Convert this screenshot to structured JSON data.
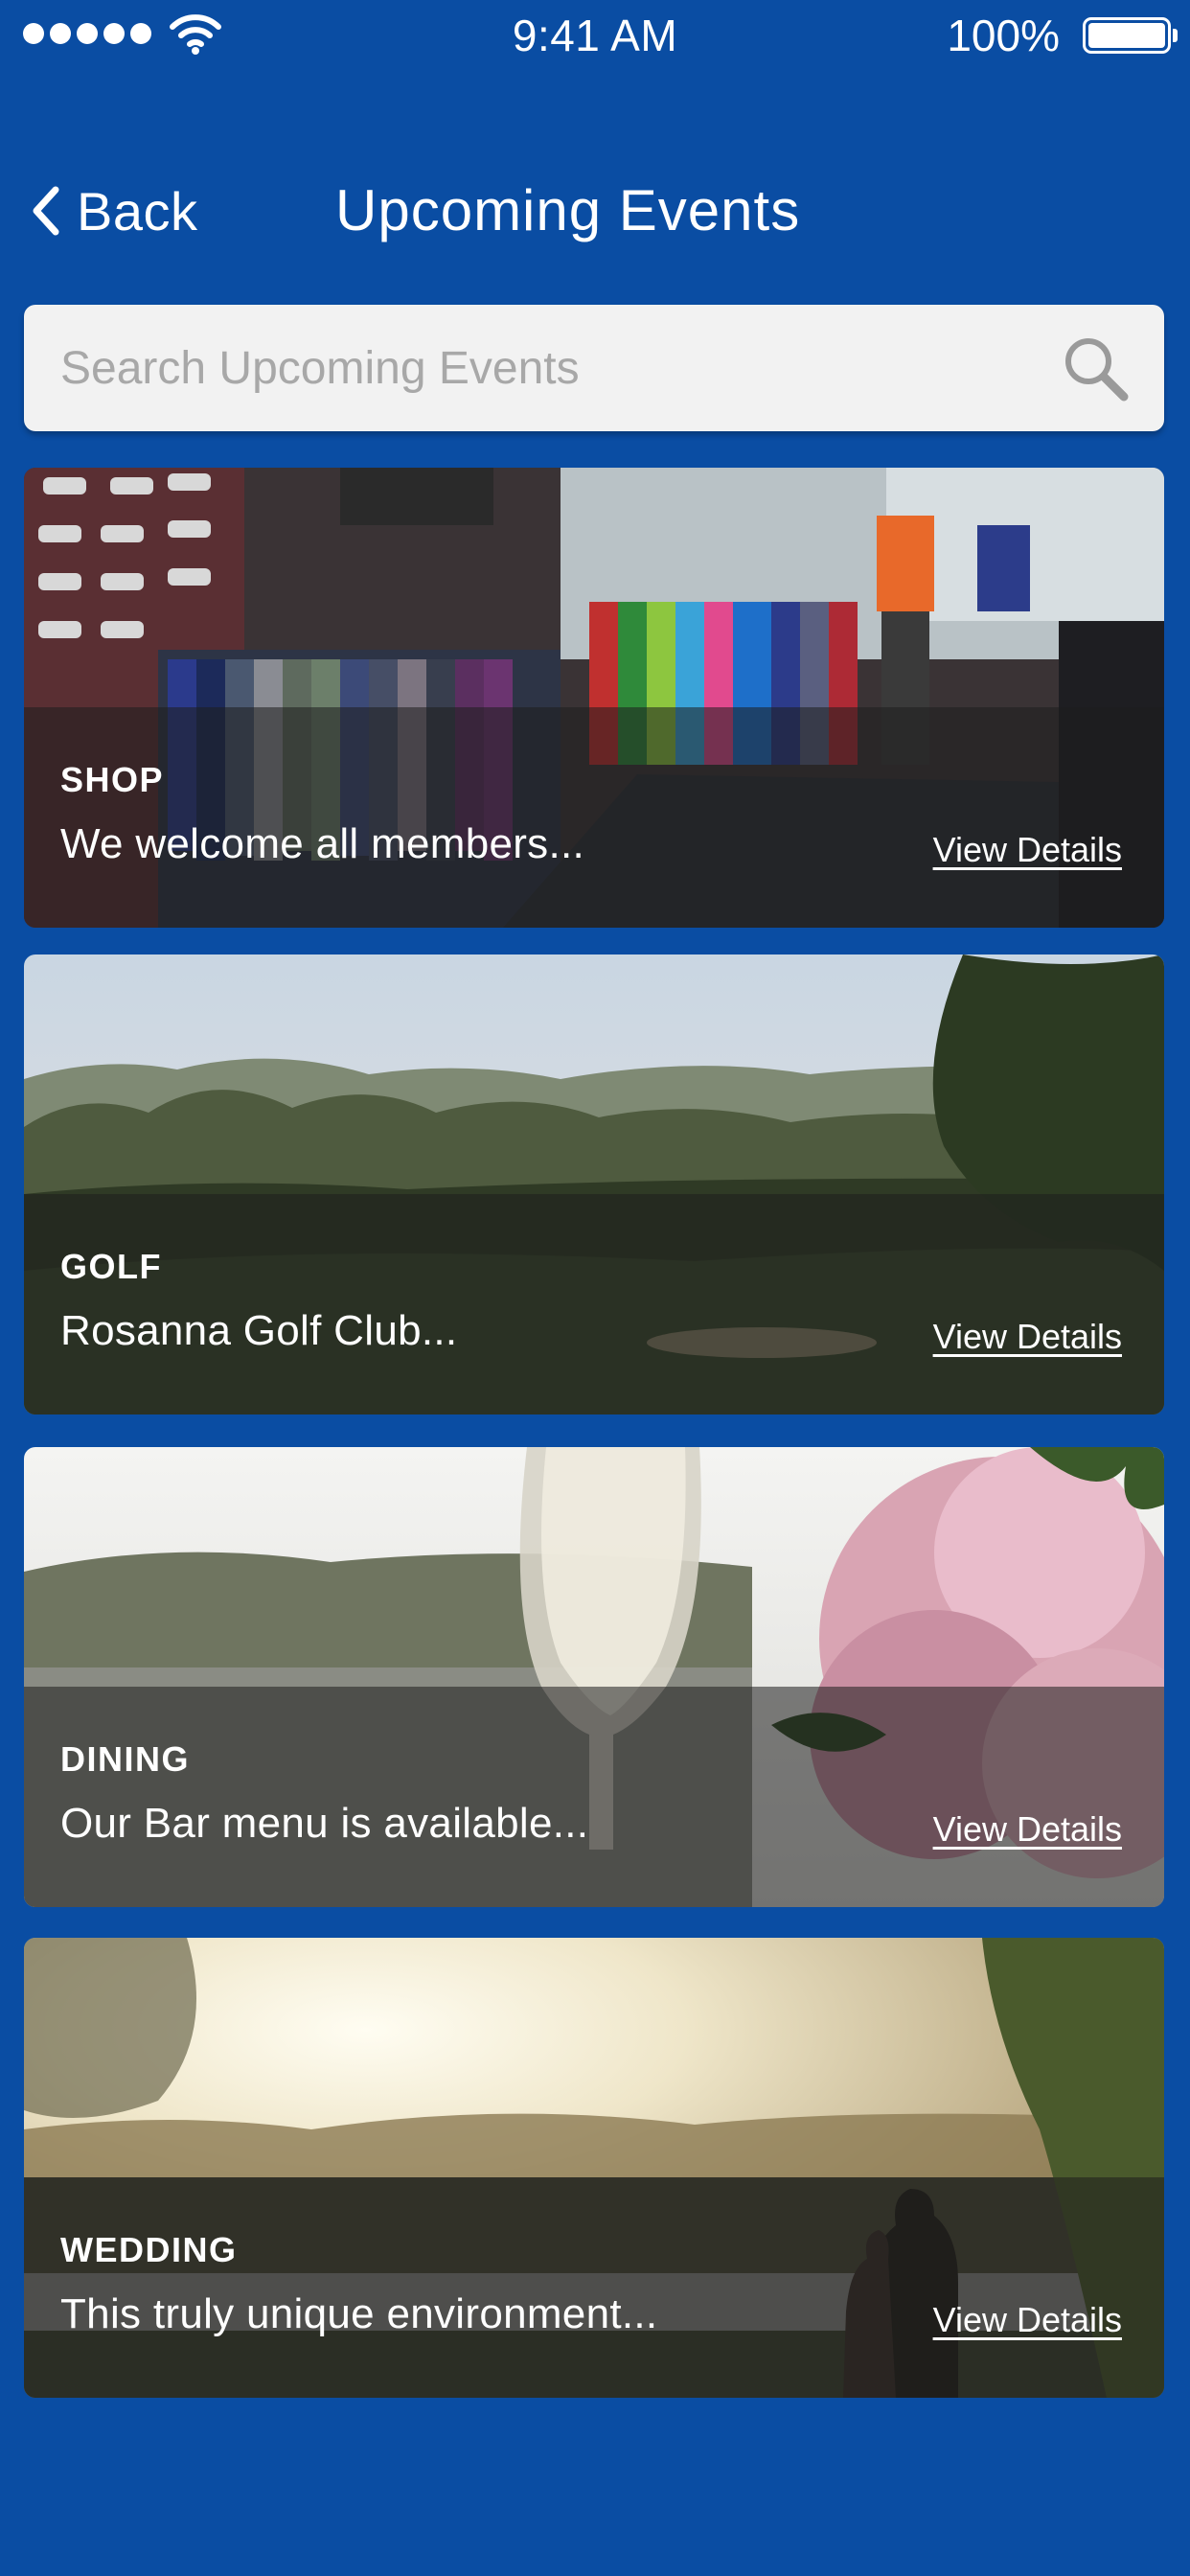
{
  "status_bar": {
    "time": "9:41 AM",
    "battery_percent": "100%",
    "signal_icon": "signal-dots-icon",
    "wifi_icon": "wifi-icon",
    "battery_icon": "battery-full-icon"
  },
  "nav": {
    "back_label": "Back",
    "back_icon": "chevron-left-icon",
    "title": "Upcoming Events"
  },
  "search": {
    "placeholder": "Search Upcoming Events",
    "value": "",
    "icon": "search-icon"
  },
  "events": [
    {
      "category": "SHOP",
      "description": "We welcome all members...",
      "link_label": "View Details"
    },
    {
      "category": "GOLF",
      "description": "Rosanna Golf Club...",
      "link_label": "View Details"
    },
    {
      "category": "DINING",
      "description": "Our Bar menu is available...",
      "link_label": "View Details"
    },
    {
      "category": "WEDDING",
      "description": "This truly unique environment...",
      "link_label": "View Details"
    }
  ],
  "colors": {
    "background": "#0a4da3",
    "search_background": "#f2f2f2",
    "placeholder": "#a8a8a8",
    "text": "#ffffff"
  }
}
